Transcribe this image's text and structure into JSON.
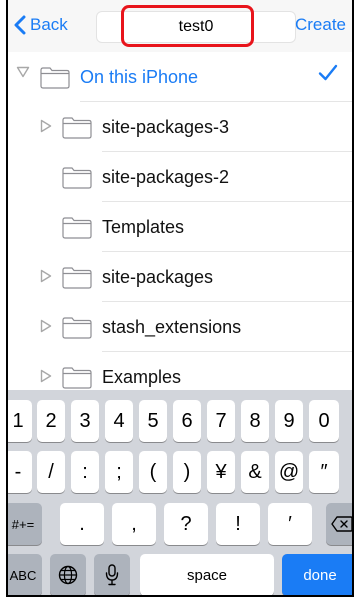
{
  "header": {
    "back_label": "Back",
    "name_value": "test0",
    "create_label": "Create"
  },
  "folders": {
    "root": {
      "label": "On this iPhone",
      "selected": true
    },
    "items": [
      {
        "label": "site-packages-3",
        "expandable": true
      },
      {
        "label": "site-packages-2",
        "expandable": false
      },
      {
        "label": "Templates",
        "expandable": false
      },
      {
        "label": "site-packages",
        "expandable": true
      },
      {
        "label": "stash_extensions",
        "expandable": true
      },
      {
        "label": "Examples",
        "expandable": true
      }
    ]
  },
  "keyboard": {
    "row1": [
      "1",
      "2",
      "3",
      "4",
      "5",
      "6",
      "7",
      "8",
      "9",
      "0"
    ],
    "row2": [
      "-",
      "/",
      ":",
      ";",
      "(",
      ")",
      "¥",
      "&",
      "@",
      "″"
    ],
    "row3": {
      "shift": "#+=",
      "keys": [
        ".",
        ",",
        "?",
        "!",
        "′"
      ]
    },
    "row4": {
      "abc": "ABC",
      "space": "space",
      "done": "done"
    }
  },
  "colors": {
    "accent": "#1a7cf5",
    "highlight": "#e8141b",
    "keyboard_bg": "#d2d5db"
  }
}
